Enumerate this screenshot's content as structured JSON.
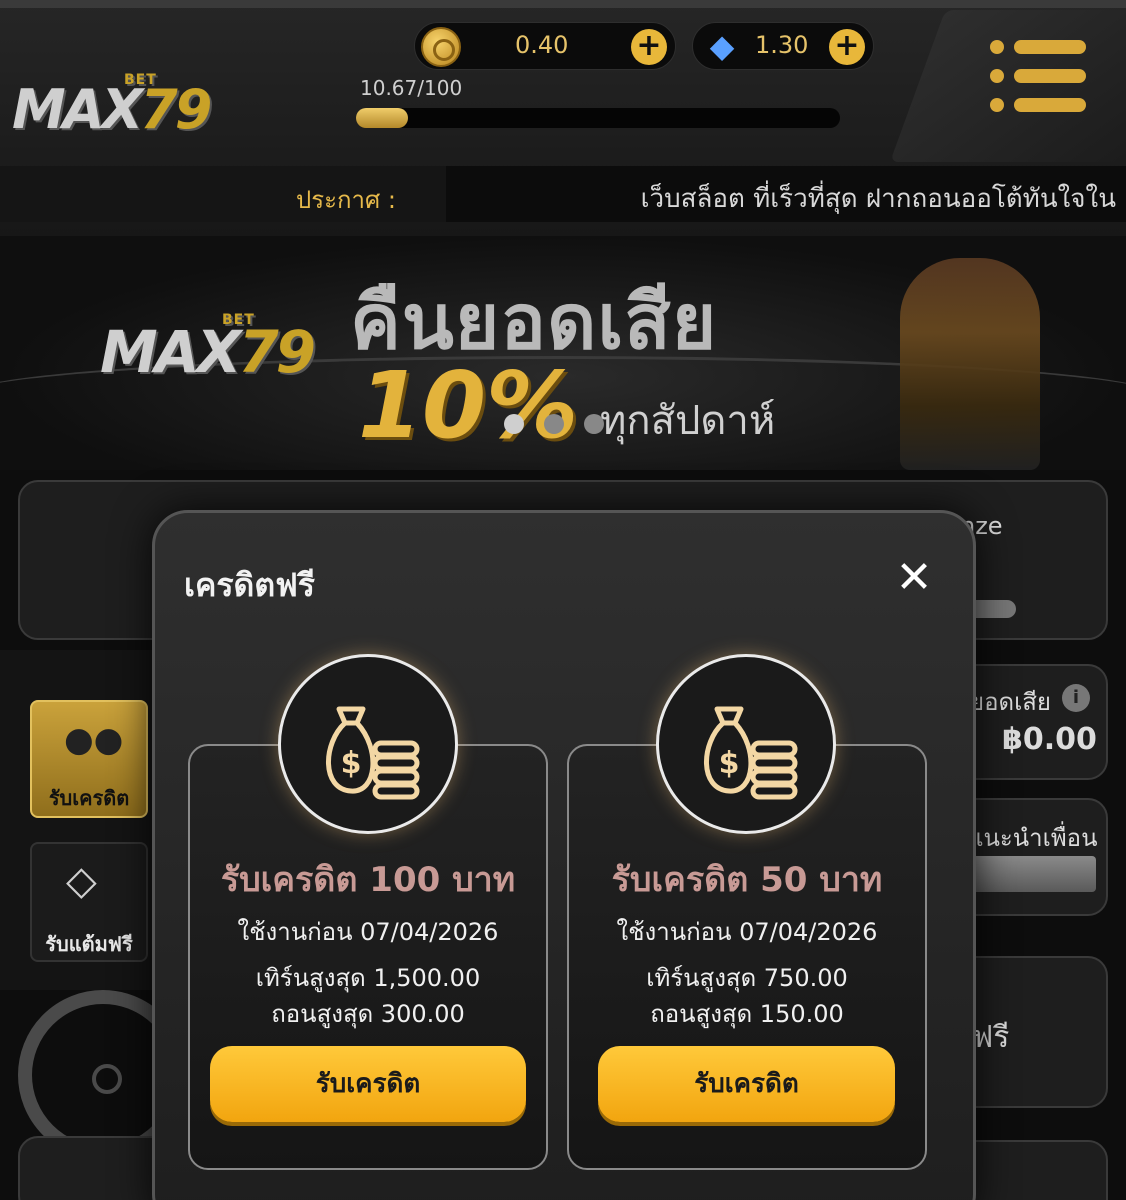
{
  "header": {
    "logo_main": "MAX",
    "logo_x": "X",
    "logo_num": "79",
    "logo_bet": "BET",
    "coin_balance": "0.40",
    "gem_balance": "1.30",
    "progress_text": "10.67/100",
    "progress_value": 0.1067,
    "announce_label": "ประกาศ :",
    "announce_text": "เว็บสล็อต ที่เร็วที่สุด ฝากถอนออโต้ทันใจใน"
  },
  "banner": {
    "title": "คืนยอดเสีย",
    "percent": "10%",
    "subtitle": "ทุกสัปดาห์",
    "slides": 3,
    "active_slide": 0
  },
  "background": {
    "card_partial_text": "nze",
    "loss_label": "ยอดเสีย",
    "loss_value": "฿0.00",
    "refer_label": "แนะนำเพื่อน",
    "free_label": "ฟรี",
    "side_receive_credit": "รับเครดิต",
    "side_free_points": "รับแต้มฟรี"
  },
  "modal": {
    "title": "เครดิตฟรี",
    "offers": [
      {
        "heading": "รับเครดิต 100 บาท",
        "use_before": "ใช้งานก่อน 07/04/2026",
        "turnover": "เทิร์นสูงสุด 1,500.00",
        "withdraw": "ถอนสูงสุด 300.00",
        "button": "รับเครดิต"
      },
      {
        "heading": "รับเครดิต 50 บาท",
        "use_before": "ใช้งานก่อน 07/04/2026",
        "turnover": "เทิร์นสูงสุด 750.00",
        "withdraw": "ถอนสูงสุด 150.00",
        "button": "รับเครดิต"
      }
    ]
  },
  "colors": {
    "gold": "#e6b94a",
    "button_yellow": "#ffc93a",
    "offer_heading": "#c89a95"
  }
}
